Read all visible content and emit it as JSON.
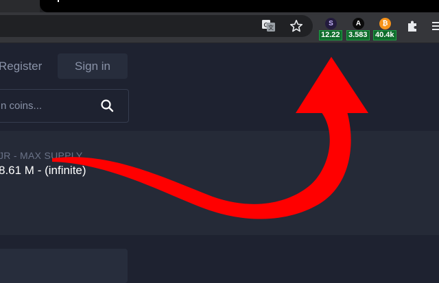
{
  "browser": {
    "extensions": [
      {
        "icon": "solana-coin-icon",
        "glyph": "S",
        "price": "12.22"
      },
      {
        "icon": "avalanche-coin-icon",
        "glyph": "A",
        "price": "3.583"
      },
      {
        "icon": "bitcoin-coin-icon",
        "glyph": "₿",
        "price": "40.4k"
      }
    ]
  },
  "nav": {
    "register_label": "Register",
    "signin_label": "Sign in"
  },
  "search": {
    "placeholder": "n coins..."
  },
  "coin_info": {
    "supply_label": "JR - MAX SUPPLY",
    "supply_value": "8.61 M - (infinite)"
  },
  "colors": {
    "background": "#1e2230",
    "price_badge": "#0f6d2c",
    "annotation_arrow": "#ff0000"
  }
}
